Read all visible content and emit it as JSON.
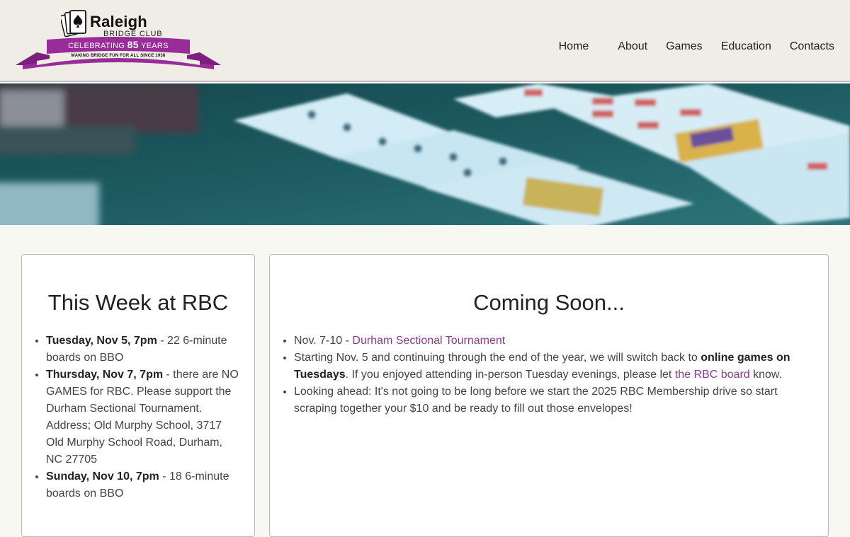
{
  "logo": {
    "title": "Raleigh",
    "subtitle": "BRIDGE  CLUB",
    "banner_prefix": "CELEBRATING",
    "banner_number": "85",
    "banner_suffix": "YEARS",
    "tagline": "MAKING BRIDGE FUN FOR ALL SINCE 1938",
    "colors": {
      "banner": "#9a2c99",
      "banner_dark": "#7d1f7e"
    }
  },
  "nav": {
    "items": [
      {
        "label": "Home"
      },
      {
        "label": "About"
      },
      {
        "label": "Games"
      },
      {
        "label": "Education"
      },
      {
        "label": "Contacts"
      }
    ]
  },
  "this_week": {
    "heading": "This Week at RBC",
    "items": [
      {
        "bold": "Tuesday, Nov 5, 7pm",
        "text": " - 22 6-minute boards on BBO"
      },
      {
        "bold": "Thursday, Nov 7, 7pm",
        "text": " - there are NO GAMES for RBC. Please support the Durham Sectional Tournament. Address; Old Murphy School, 3717 Old Murphy School Road, Durham, NC 27705"
      },
      {
        "bold": "Sunday, Nov 10, 7pm",
        "text": " - 18 6-minute boards on BBO"
      }
    ]
  },
  "coming_soon": {
    "heading": "Coming Soon...",
    "item1": {
      "prefix": "Nov. 7-10 - ",
      "link": "Durham Sectional Tournament"
    },
    "item2": {
      "prefix": "Starting Nov. 5 and continuing through the end of the year, we will switch back to ",
      "bold": "online games on Tuesdays",
      "middle": ". If you enjoyed attending in-person Tuesday evenings, please let ",
      "link": "the RBC board",
      "suffix": " know."
    },
    "item3": {
      "text": "Looking ahead: It's not going to be long before we start the 2025 RBC Membership drive so start scraping together your $10 and be ready to fill out those envelopes!"
    }
  },
  "colors": {
    "link": "#8b3b93",
    "header_bg": "#efede5",
    "page_bg": "#f8f8f3"
  }
}
